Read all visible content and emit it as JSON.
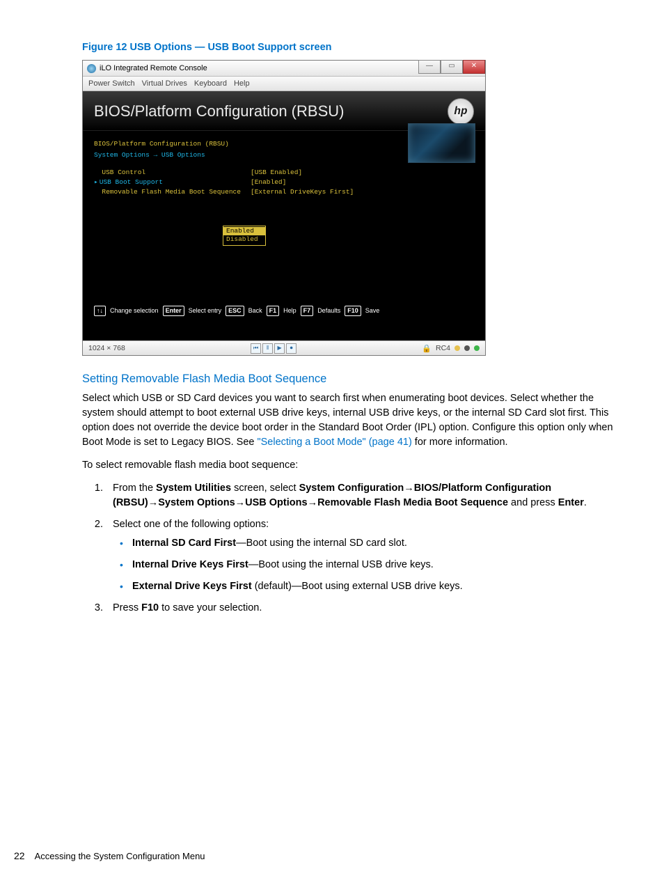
{
  "figure_caption": "Figure 12 USB Options — USB Boot Support screen",
  "console": {
    "window_title": "iLO Integrated Remote Console",
    "menubar": [
      "Power Switch",
      "Virtual Drives",
      "Keyboard",
      "Help"
    ],
    "bios_title": "BIOS/Platform Configuration (RBSU)",
    "logo": "hp",
    "breadcrumb1": "BIOS/Platform Configuration (RBSU)",
    "breadcrumb2": "System Options → USB Options",
    "options": [
      {
        "label": "USB Control",
        "value": "[USB Enabled]",
        "selected": false
      },
      {
        "label": "USB Boot Support",
        "value": "[Enabled]",
        "selected": true
      },
      {
        "label": "Removable Flash Media Boot Sequence",
        "value": "[External DriveKeys First]",
        "selected": false
      }
    ],
    "popup": {
      "items": [
        "Enabled",
        "Disabled"
      ],
      "highlighted": 0
    },
    "footer_keys": [
      {
        "key": "↑↓",
        "label": "Change selection"
      },
      {
        "key": "Enter",
        "label": "Select entry"
      },
      {
        "key": "ESC",
        "label": "Back"
      },
      {
        "key": "F1",
        "label": "Help"
      },
      {
        "key": "F7",
        "label": "Defaults"
      },
      {
        "key": "F10",
        "label": "Save"
      }
    ],
    "statusbar": {
      "resolution": "1024 × 768",
      "rc": "RC4",
      "center_buttons": [
        "⏮",
        "‖",
        "▶",
        "⏺"
      ]
    }
  },
  "heading2": "Setting Removable Flash Media Boot Sequence",
  "para1_a": "Select which USB or SD Card devices you want to search first when enumerating boot devices. Select whether the system should attempt to boot external USB drive keys, internal USB drive keys, or the internal SD Card slot first. This option does not override the device boot order in the Standard Boot Order (IPL) option. Configure this option only when Boot Mode is set to Legacy BIOS. See ",
  "para1_link": "\"Selecting a Boot Mode\" (page 41)",
  "para1_b": " for more information.",
  "para2": "To select removable flash media boot sequence:",
  "steps": {
    "s1_a": "From the ",
    "s1_b1": "System Utilities",
    "s1_c": " screen, select ",
    "s1_b2": "System Configuration",
    "arrow": "→",
    "s1_b3": "BIOS/Platform Configuration (RBSU)",
    "s1_b4": "System Options",
    "s1_b5": "USB Options",
    "s1_b6": "Removable Flash Media Boot Sequence",
    "s1_d": " and press ",
    "s1_b7": "Enter",
    "s1_e": ".",
    "s2": "Select one of the following options:",
    "bullets": [
      {
        "bold": "Internal SD Card First",
        "rest": "—Boot using the internal SD card slot."
      },
      {
        "bold": "Internal Drive Keys First",
        "rest": "—Boot using the internal USB drive keys."
      },
      {
        "bold": "External Drive Keys First",
        "mid": " (default)",
        "rest": "—Boot using external USB drive keys."
      }
    ],
    "s3_a": "Press ",
    "s3_b": "F10",
    "s3_c": " to save your selection."
  },
  "footer": {
    "page": "22",
    "title": "Accessing the System Configuration Menu"
  }
}
